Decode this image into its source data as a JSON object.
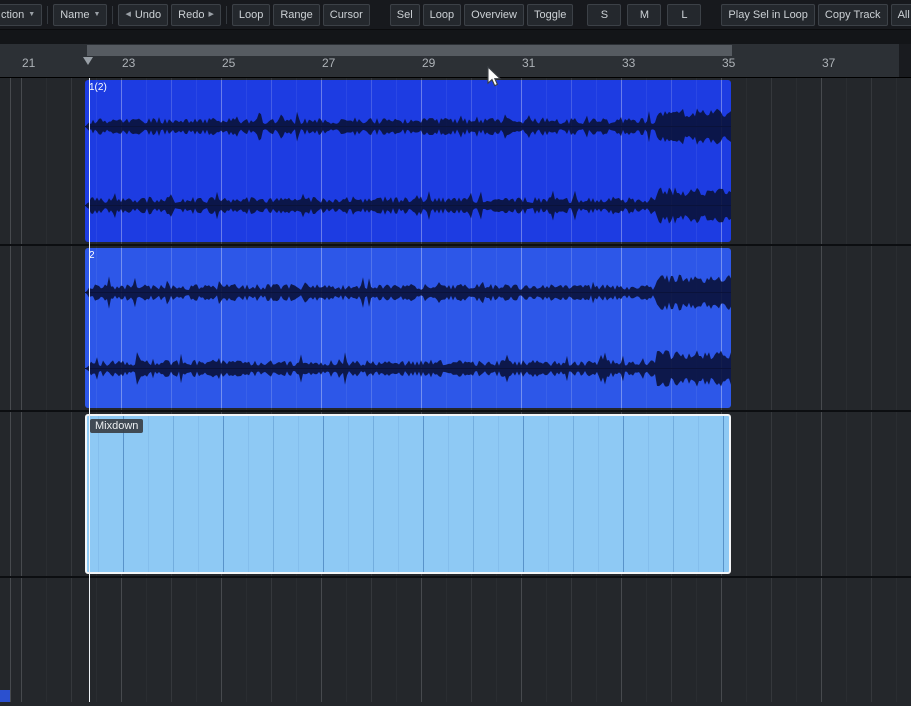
{
  "toolbar": {
    "buttons": [
      {
        "label": "ction"
      },
      {
        "label": "Name"
      },
      {
        "label": "Undo"
      },
      {
        "label": "Redo"
      },
      {
        "label": "Loop"
      },
      {
        "label": "Range"
      },
      {
        "label": "Cursor"
      },
      {
        "label": "Sel"
      },
      {
        "label": "Loop"
      },
      {
        "label": "Overview"
      },
      {
        "label": "Toggle"
      },
      {
        "label": "S"
      },
      {
        "label": "M"
      },
      {
        "label": "L"
      },
      {
        "label": "Play Sel in Loop"
      },
      {
        "label": "Copy Track"
      },
      {
        "label": "All FX"
      }
    ],
    "dropdown_icon": "▼",
    "undo_icon": "◀",
    "redo_icon": "▶"
  },
  "ruler": {
    "labels": [
      "21",
      "23",
      "25",
      "27",
      "29",
      "31",
      "33",
      "35",
      "37"
    ]
  },
  "tracks": [
    {
      "clip": {
        "label": "1(2)",
        "type": "audio-stereo"
      }
    },
    {
      "clip": {
        "label": "2",
        "type": "audio-stereo"
      }
    },
    {
      "clip": {
        "label": "Mixdown",
        "type": "empty",
        "selected": true
      }
    },
    {
      "clip": null
    }
  ],
  "colors": {
    "clip_track1": "#1d3ce2",
    "clip_track2": "#2d57e8",
    "clip_mixdown": "#8ec9f4",
    "waveform": "#0a123a",
    "selection_border": "#f3f5f7",
    "edit_cursor": "#eef2f6",
    "corner_accent": "#2b50cf"
  }
}
